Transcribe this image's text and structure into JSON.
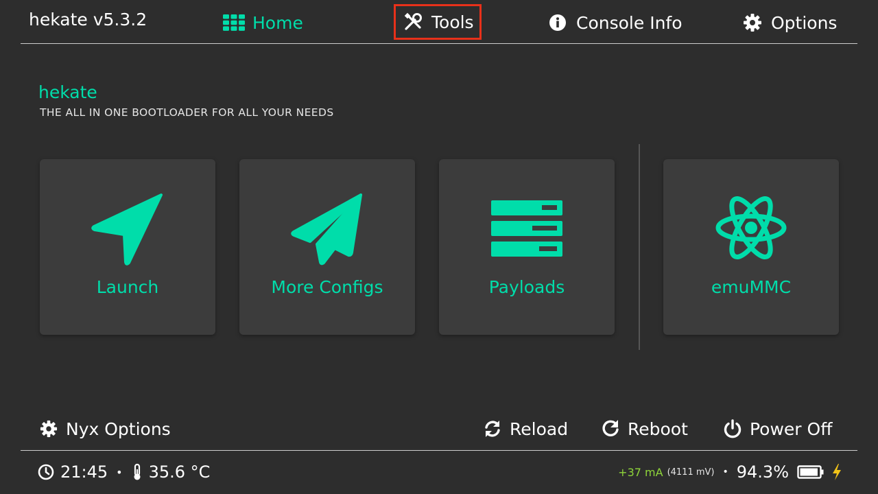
{
  "app": {
    "title": "hekate v5.3.2"
  },
  "nav": {
    "home": "Home",
    "tools": "Tools",
    "console_info": "Console Info",
    "options": "Options"
  },
  "brand": {
    "title": "hekate",
    "subtitle": "THE ALL IN ONE BOOTLOADER FOR ALL YOUR NEEDS"
  },
  "tiles": [
    {
      "label": "Launch",
      "icon": "navigation-arrow-icon"
    },
    {
      "label": "More Configs",
      "icon": "paper-plane-icon"
    },
    {
      "label": "Payloads",
      "icon": "server-list-icon"
    },
    {
      "label": "emuMMC",
      "icon": "atom-icon"
    }
  ],
  "actions": {
    "nyx_options": "Nyx Options",
    "reload": "Reload",
    "reboot": "Reboot",
    "power_off": "Power Off"
  },
  "status": {
    "time": "21:45",
    "temperature": "35.6 °C",
    "current": "+37 mA",
    "voltage": "(4111 mV)",
    "battery_percent": "94.3%",
    "battery_level": 0.943,
    "charging": true
  },
  "colors": {
    "accent": "#00ddaa",
    "background": "#2d2d2d",
    "tile": "#3c3c3c",
    "highlight_box": "#e8311a",
    "current_text": "#8fd63a",
    "charge_bolt": "#f2c318"
  }
}
